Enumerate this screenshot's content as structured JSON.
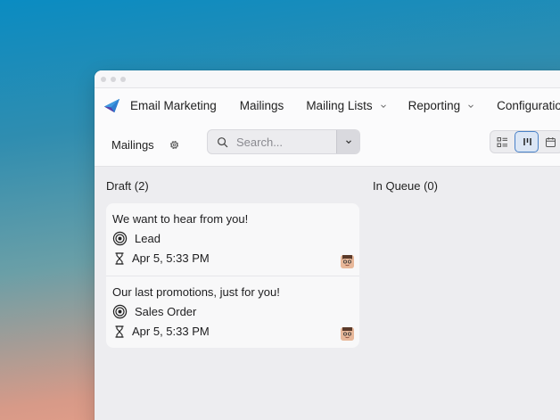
{
  "navbar": {
    "app_title": "Email Marketing",
    "items": [
      {
        "label": "Mailings"
      },
      {
        "label": "Mailing Lists"
      },
      {
        "label": "Reporting"
      },
      {
        "label": "Configuratio"
      }
    ]
  },
  "controlbar": {
    "breadcrumb": "Mailings",
    "search_placeholder": "Search..."
  },
  "columns": [
    {
      "title": "Draft (2)"
    },
    {
      "title": "In Queue (0)"
    }
  ],
  "cards": [
    {
      "title": "We want to hear from you!",
      "recipient_model": "Lead",
      "date": "Apr 5, 5:33 PM"
    },
    {
      "title": "Our last promotions, just for you!",
      "recipient_model": "Sales Order",
      "date": "Apr 5, 5:33 PM"
    }
  ],
  "icons": [
    "app-logo-icon",
    "chevron-down-icon",
    "gear-icon",
    "search-icon",
    "list-view-icon",
    "kanban-view-icon",
    "calendar-view-icon",
    "target-icon",
    "hourglass-icon",
    "avatar"
  ],
  "colors": {
    "accent": "#4a82c8",
    "logo_blue": "#1f5fb3",
    "logo_purple": "#6c4fb0"
  }
}
